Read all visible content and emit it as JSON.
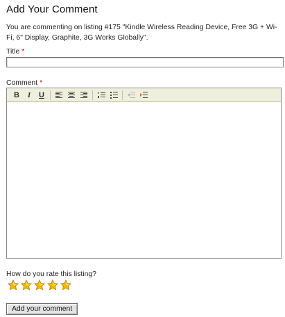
{
  "heading": "Add Your Comment",
  "intro": "You are commenting on listing #175 \"Kindle Wireless Reading Device, Free 3G + Wi-Fi, 6\" Display, Graphite, 3G Works Globally\".",
  "title_field": {
    "label": "Title",
    "required_mark": "*",
    "value": ""
  },
  "comment_field": {
    "label": "Comment",
    "required_mark": "*",
    "value": "",
    "toolbar": {
      "bold": "B",
      "italic": "I",
      "underline": "U",
      "icons": [
        "align-left-icon",
        "align-center-icon",
        "align-right-icon",
        "ordered-list-icon",
        "unordered-list-icon",
        "outdent-icon",
        "indent-icon"
      ]
    }
  },
  "rating": {
    "question": "How do you rate this listing?",
    "max": 5,
    "selected": 5,
    "star_color": "#f5b800"
  },
  "submit_label": "Add your comment"
}
